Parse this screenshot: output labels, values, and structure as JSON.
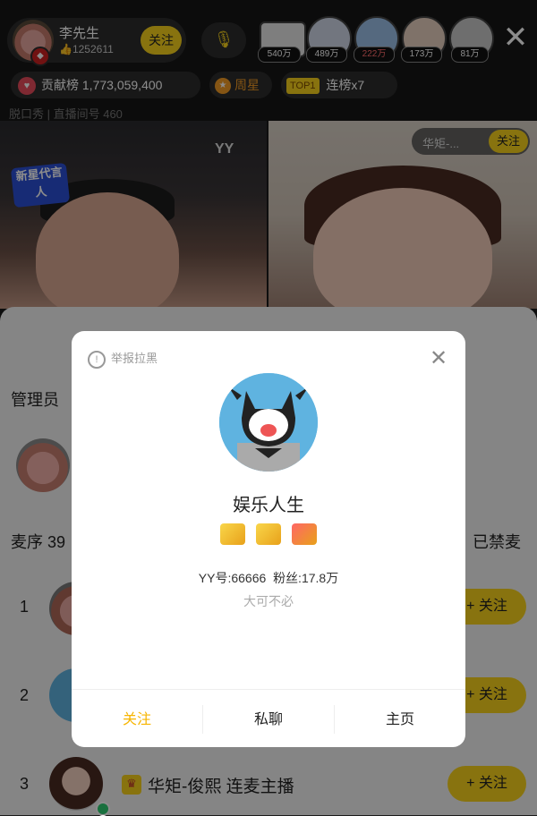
{
  "host": {
    "name": "李先生",
    "likes": "1252611",
    "follow_label": "关注"
  },
  "fans": [
    {
      "count": "540万",
      "color": "#d4d4d4"
    },
    {
      "count": "489万",
      "color": "#cfd8e8"
    },
    {
      "count": "222万",
      "color": "#9bc0e8"
    },
    {
      "count": "173万",
      "color": "#e8d0c0"
    },
    {
      "count": "81万",
      "color": "#c8c8c8"
    }
  ],
  "contribution": {
    "label": "贡献榜",
    "value": "1,773,059,400"
  },
  "weekly_star": {
    "label": "周星"
  },
  "rank_badge": {
    "top": "TOP1",
    "streak": "连榜x7"
  },
  "room_info": "脱口秀 | 直播间号 460",
  "video": {
    "left_logo": "YY",
    "left_tag": "新星代言人",
    "guest_name": "华矩-...",
    "guest_follow": "关注"
  },
  "sheet": {
    "admin_label": "管理员",
    "queue_label": "麦序 39",
    "muted_label": "已禁麦",
    "rows": [
      {
        "rank": "1",
        "follow": "+ 关注"
      },
      {
        "rank": "2",
        "follow": "+ 关注"
      },
      {
        "rank": "3",
        "name": "华矩-俊熙 连麦主播",
        "follow": "+ 关注"
      }
    ]
  },
  "modal": {
    "report_label": "举报拉黑",
    "nickname": "娱乐人生",
    "yy_id": "YY号:66666",
    "fans": "粉丝:17.8万",
    "signature": "大可不必",
    "buttons": {
      "follow": "关注",
      "message": "私聊",
      "homepage": "主页"
    },
    "accent_color": "#f7b500"
  }
}
